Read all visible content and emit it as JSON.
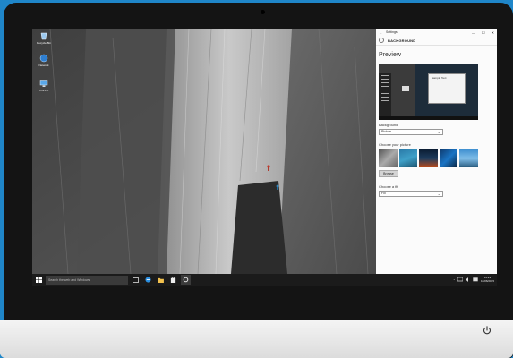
{
  "desktop": {
    "icons": [
      {
        "label": "Recycle Bin"
      },
      {
        "label": "Network"
      },
      {
        "label": "This PC"
      }
    ]
  },
  "settings": {
    "window_title": "Settings",
    "back_glyph": "←",
    "minimize_glyph": "—",
    "maximize_glyph": "☐",
    "close_glyph": "✕",
    "header": "BACKGROUND",
    "preview_title": "Preview",
    "preview_window_text": "Sample Text",
    "background_label": "Background",
    "background_value": "Picture",
    "choose_picture_label": "Choose your picture",
    "browse_label": "Browse",
    "choose_fit_label": "Choose a fit",
    "fit_value": "Fill"
  },
  "taskbar": {
    "search_placeholder": "Search the web and Windows",
    "time": "11:23",
    "date": "16/06/2015"
  },
  "colors": {
    "background": "#1f86c9",
    "accent": "#0078d7",
    "taskbar": "#1b1b1b"
  }
}
